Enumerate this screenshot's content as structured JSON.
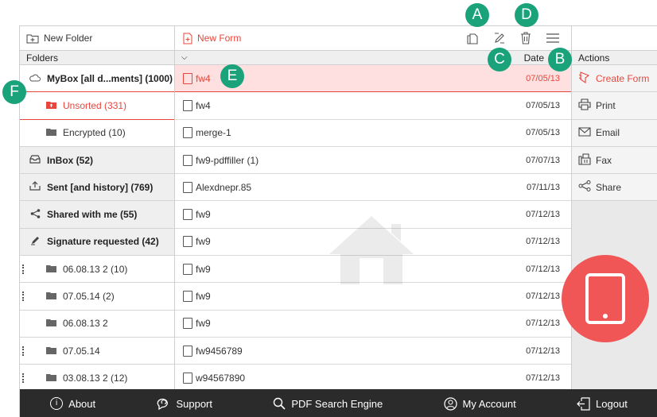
{
  "toolbar": {
    "new_folder": "New Folder",
    "new_form": "New Form"
  },
  "headers": {
    "folders": "Folders",
    "date": "Date",
    "actions": "Actions"
  },
  "folders": [
    {
      "label": "MyBox [all d...ments] (1000)"
    },
    {
      "label": "Unsorted (331)"
    },
    {
      "label": "Encrypted (10)"
    },
    {
      "label": "InBox (52)"
    },
    {
      "label": "Sent [and history] (769)"
    },
    {
      "label": "Shared with me (55)"
    },
    {
      "label": "Signature requested (42)"
    },
    {
      "label": "06.08.13 2 (10)"
    },
    {
      "label": "07.05.14 (2)"
    },
    {
      "label": "06.08.13 2"
    },
    {
      "label": "07.05.14"
    },
    {
      "label": "03.08.13 2 (12)"
    }
  ],
  "files": [
    {
      "name": "fw4",
      "date": "07/05/13"
    },
    {
      "name": "fw4",
      "date": "07/05/13"
    },
    {
      "name": "merge-1",
      "date": "07/05/13"
    },
    {
      "name": "fw9-pdffiller (1)",
      "date": "07/07/13"
    },
    {
      "name": "Alexdnepr.85",
      "date": "07/11/13"
    },
    {
      "name": "fw9",
      "date": "07/12/13"
    },
    {
      "name": "fw9",
      "date": "07/12/13"
    },
    {
      "name": "fw9",
      "date": "07/12/13"
    },
    {
      "name": "fw9",
      "date": "07/12/13"
    },
    {
      "name": "fw9",
      "date": "07/12/13"
    },
    {
      "name": "fw9456789",
      "date": "07/12/13"
    },
    {
      "name": "w94567890",
      "date": "07/12/13"
    }
  ],
  "actions": [
    {
      "label": "Create Form",
      "icon": "create-form-icon"
    },
    {
      "label": "Print",
      "icon": "print-icon"
    },
    {
      "label": "Email",
      "icon": "email-icon"
    },
    {
      "label": "Fax",
      "icon": "fax-icon"
    },
    {
      "label": "Share",
      "icon": "share-icon"
    }
  ],
  "footer": {
    "about": "About",
    "support": "Support",
    "pdf_search": "PDF Search Engine",
    "my_account": "My Account",
    "logout": "Logout"
  },
  "markers": {
    "a": "A",
    "b": "B",
    "c": "C",
    "d": "D",
    "e": "E",
    "f": "F"
  },
  "colors": {
    "accent": "#e8463c",
    "marker": "#1aa37a",
    "footer": "#2b2b2b",
    "tablet_circle": "#f05656"
  }
}
